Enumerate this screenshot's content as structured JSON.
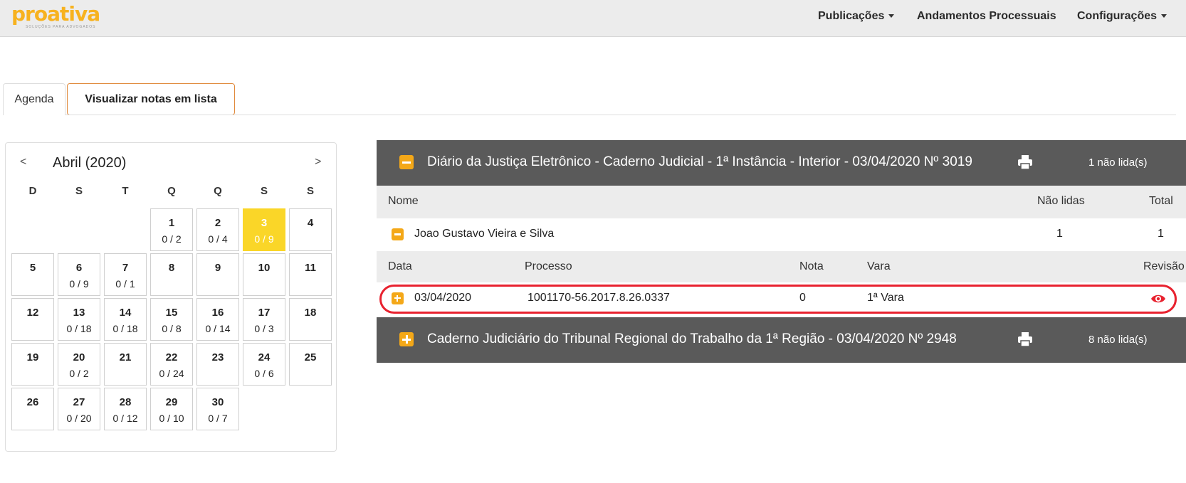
{
  "navbar": {
    "logo_text": "proativa",
    "logo_tagline": "SOLUÇÕES PARA ADVOGADOS",
    "items": [
      {
        "label": "Publicações",
        "dropdown": true
      },
      {
        "label": "Andamentos Processuais",
        "dropdown": false
      },
      {
        "label": "Configurações",
        "dropdown": true
      }
    ]
  },
  "tabs": {
    "agenda": "Agenda",
    "list": "Visualizar notas em lista"
  },
  "calendar": {
    "prev": "<",
    "next": ">",
    "title": "Abril (2020)",
    "weekdays": [
      "D",
      "S",
      "T",
      "Q",
      "Q",
      "S",
      "S"
    ],
    "days": [
      {
        "day": "1",
        "count": "0 / 2"
      },
      {
        "day": "2",
        "count": "0 / 4"
      },
      {
        "day": "3",
        "count": "0 / 9",
        "selected": true
      },
      {
        "day": "4",
        "count": ""
      },
      {
        "day": "5",
        "count": ""
      },
      {
        "day": "6",
        "count": "0 / 9"
      },
      {
        "day": "7",
        "count": "0 / 1"
      },
      {
        "day": "8",
        "count": ""
      },
      {
        "day": "9",
        "count": ""
      },
      {
        "day": "10",
        "count": ""
      },
      {
        "day": "11",
        "count": ""
      },
      {
        "day": "12",
        "count": ""
      },
      {
        "day": "13",
        "count": "0 / 18"
      },
      {
        "day": "14",
        "count": "0 / 18"
      },
      {
        "day": "15",
        "count": "0 / 8"
      },
      {
        "day": "16",
        "count": "0 / 14"
      },
      {
        "day": "17",
        "count": "0 / 3"
      },
      {
        "day": "18",
        "count": ""
      },
      {
        "day": "19",
        "count": ""
      },
      {
        "day": "20",
        "count": "0 / 2"
      },
      {
        "day": "21",
        "count": ""
      },
      {
        "day": "22",
        "count": "0 / 24"
      },
      {
        "day": "23",
        "count": ""
      },
      {
        "day": "24",
        "count": "0 / 6"
      },
      {
        "day": "25",
        "count": ""
      },
      {
        "day": "26",
        "count": ""
      },
      {
        "day": "27",
        "count": "0 / 20"
      },
      {
        "day": "28",
        "count": "0 / 12"
      },
      {
        "day": "29",
        "count": "0 / 10"
      },
      {
        "day": "30",
        "count": "0 / 7"
      }
    ]
  },
  "publications": [
    {
      "title": "Diário da Justiça Eletrônico - Caderno Judicial - 1ª Instância - Interior - 03/04/2020 Nº 3019",
      "unread": "1 não lida(s)",
      "expanded": true
    },
    {
      "title": "Caderno Judiciário do Tribunal Regional do Trabalho da 1ª Região - 03/04/2020 Nº 2948",
      "unread": "8 não lida(s)",
      "expanded": false
    }
  ],
  "names_table": {
    "headers": {
      "name": "Nome",
      "unread": "Não lidas",
      "total": "Total"
    },
    "rows": [
      {
        "name": "Joao Gustavo Vieira e Silva",
        "unread": "1",
        "total": "1"
      }
    ]
  },
  "notes_table": {
    "headers": {
      "date": "Data",
      "process": "Processo",
      "note": "Nota",
      "court": "Vara",
      "review": "Revisão"
    },
    "rows": [
      {
        "date": "03/04/2020",
        "process": "1001170-56.2017.8.26.0337",
        "note": "0",
        "court": "1ª Vara"
      }
    ]
  },
  "colors": {
    "brand": "#f7b21f",
    "accent_orange": "#f4a818",
    "today": "#fad628",
    "panel_header": "#5a5a5a",
    "highlight": "#e8222f"
  }
}
